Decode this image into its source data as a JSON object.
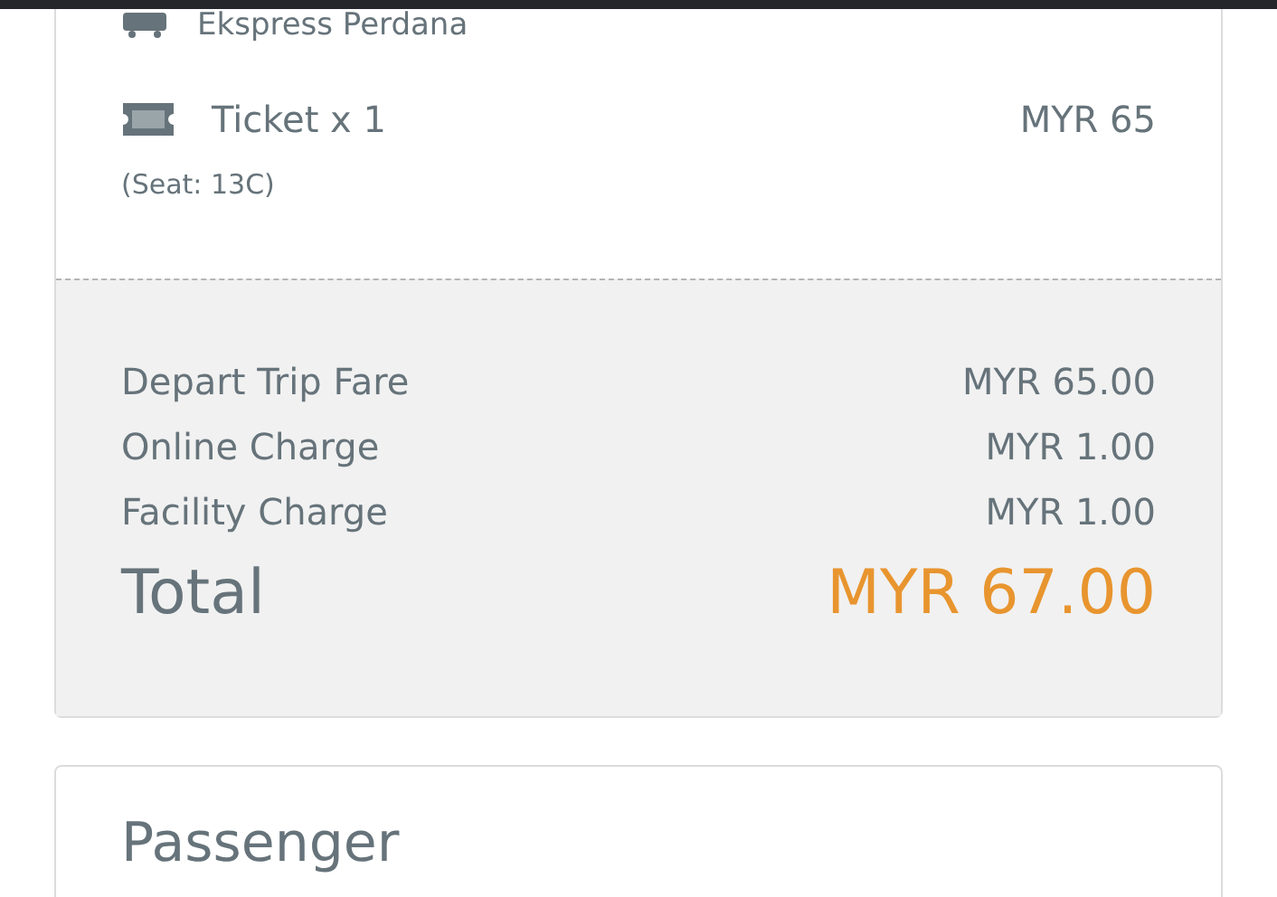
{
  "operator": {
    "name": "Ekspress Perdana"
  },
  "ticket": {
    "label": "Ticket x 1",
    "price": "MYR 65",
    "seat": "(Seat: 13C)"
  },
  "charges": [
    {
      "label": "Depart Trip Fare",
      "amount": "MYR 65.00"
    },
    {
      "label": "Online Charge",
      "amount": "MYR 1.00"
    },
    {
      "label": "Facility Charge",
      "amount": "MYR 1.00"
    }
  ],
  "total": {
    "label": "Total",
    "amount": "MYR 67.00"
  },
  "passenger": {
    "heading": "Passenger"
  }
}
